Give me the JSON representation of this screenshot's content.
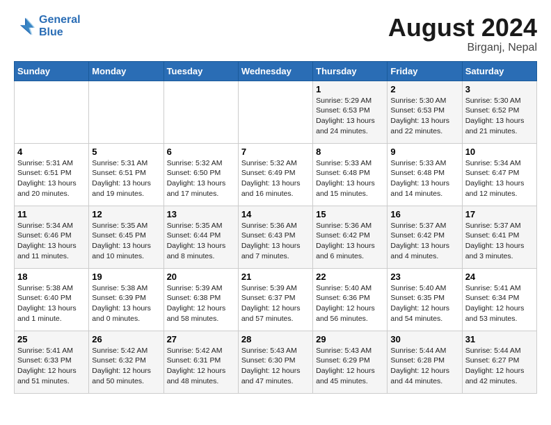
{
  "header": {
    "logo_line1": "General",
    "logo_line2": "Blue",
    "month_title": "August 2024",
    "location": "Birganj, Nepal"
  },
  "weekdays": [
    "Sunday",
    "Monday",
    "Tuesday",
    "Wednesday",
    "Thursday",
    "Friday",
    "Saturday"
  ],
  "weeks": [
    [
      {
        "day": "",
        "info": ""
      },
      {
        "day": "",
        "info": ""
      },
      {
        "day": "",
        "info": ""
      },
      {
        "day": "",
        "info": ""
      },
      {
        "day": "1",
        "info": "Sunrise: 5:29 AM\nSunset: 6:53 PM\nDaylight: 13 hours\nand 24 minutes."
      },
      {
        "day": "2",
        "info": "Sunrise: 5:30 AM\nSunset: 6:53 PM\nDaylight: 13 hours\nand 22 minutes."
      },
      {
        "day": "3",
        "info": "Sunrise: 5:30 AM\nSunset: 6:52 PM\nDaylight: 13 hours\nand 21 minutes."
      }
    ],
    [
      {
        "day": "4",
        "info": "Sunrise: 5:31 AM\nSunset: 6:51 PM\nDaylight: 13 hours\nand 20 minutes."
      },
      {
        "day": "5",
        "info": "Sunrise: 5:31 AM\nSunset: 6:51 PM\nDaylight: 13 hours\nand 19 minutes."
      },
      {
        "day": "6",
        "info": "Sunrise: 5:32 AM\nSunset: 6:50 PM\nDaylight: 13 hours\nand 17 minutes."
      },
      {
        "day": "7",
        "info": "Sunrise: 5:32 AM\nSunset: 6:49 PM\nDaylight: 13 hours\nand 16 minutes."
      },
      {
        "day": "8",
        "info": "Sunrise: 5:33 AM\nSunset: 6:48 PM\nDaylight: 13 hours\nand 15 minutes."
      },
      {
        "day": "9",
        "info": "Sunrise: 5:33 AM\nSunset: 6:48 PM\nDaylight: 13 hours\nand 14 minutes."
      },
      {
        "day": "10",
        "info": "Sunrise: 5:34 AM\nSunset: 6:47 PM\nDaylight: 13 hours\nand 12 minutes."
      }
    ],
    [
      {
        "day": "11",
        "info": "Sunrise: 5:34 AM\nSunset: 6:46 PM\nDaylight: 13 hours\nand 11 minutes."
      },
      {
        "day": "12",
        "info": "Sunrise: 5:35 AM\nSunset: 6:45 PM\nDaylight: 13 hours\nand 10 minutes."
      },
      {
        "day": "13",
        "info": "Sunrise: 5:35 AM\nSunset: 6:44 PM\nDaylight: 13 hours\nand 8 minutes."
      },
      {
        "day": "14",
        "info": "Sunrise: 5:36 AM\nSunset: 6:43 PM\nDaylight: 13 hours\nand 7 minutes."
      },
      {
        "day": "15",
        "info": "Sunrise: 5:36 AM\nSunset: 6:42 PM\nDaylight: 13 hours\nand 6 minutes."
      },
      {
        "day": "16",
        "info": "Sunrise: 5:37 AM\nSunset: 6:42 PM\nDaylight: 13 hours\nand 4 minutes."
      },
      {
        "day": "17",
        "info": "Sunrise: 5:37 AM\nSunset: 6:41 PM\nDaylight: 13 hours\nand 3 minutes."
      }
    ],
    [
      {
        "day": "18",
        "info": "Sunrise: 5:38 AM\nSunset: 6:40 PM\nDaylight: 13 hours\nand 1 minute."
      },
      {
        "day": "19",
        "info": "Sunrise: 5:38 AM\nSunset: 6:39 PM\nDaylight: 13 hours\nand 0 minutes."
      },
      {
        "day": "20",
        "info": "Sunrise: 5:39 AM\nSunset: 6:38 PM\nDaylight: 12 hours\nand 58 minutes."
      },
      {
        "day": "21",
        "info": "Sunrise: 5:39 AM\nSunset: 6:37 PM\nDaylight: 12 hours\nand 57 minutes."
      },
      {
        "day": "22",
        "info": "Sunrise: 5:40 AM\nSunset: 6:36 PM\nDaylight: 12 hours\nand 56 minutes."
      },
      {
        "day": "23",
        "info": "Sunrise: 5:40 AM\nSunset: 6:35 PM\nDaylight: 12 hours\nand 54 minutes."
      },
      {
        "day": "24",
        "info": "Sunrise: 5:41 AM\nSunset: 6:34 PM\nDaylight: 12 hours\nand 53 minutes."
      }
    ],
    [
      {
        "day": "25",
        "info": "Sunrise: 5:41 AM\nSunset: 6:33 PM\nDaylight: 12 hours\nand 51 minutes."
      },
      {
        "day": "26",
        "info": "Sunrise: 5:42 AM\nSunset: 6:32 PM\nDaylight: 12 hours\nand 50 minutes."
      },
      {
        "day": "27",
        "info": "Sunrise: 5:42 AM\nSunset: 6:31 PM\nDaylight: 12 hours\nand 48 minutes."
      },
      {
        "day": "28",
        "info": "Sunrise: 5:43 AM\nSunset: 6:30 PM\nDaylight: 12 hours\nand 47 minutes."
      },
      {
        "day": "29",
        "info": "Sunrise: 5:43 AM\nSunset: 6:29 PM\nDaylight: 12 hours\nand 45 minutes."
      },
      {
        "day": "30",
        "info": "Sunrise: 5:44 AM\nSunset: 6:28 PM\nDaylight: 12 hours\nand 44 minutes."
      },
      {
        "day": "31",
        "info": "Sunrise: 5:44 AM\nSunset: 6:27 PM\nDaylight: 12 hours\nand 42 minutes."
      }
    ]
  ],
  "colors": {
    "header_bg": "#2a6db5",
    "logo_blue": "#2a6db5"
  }
}
